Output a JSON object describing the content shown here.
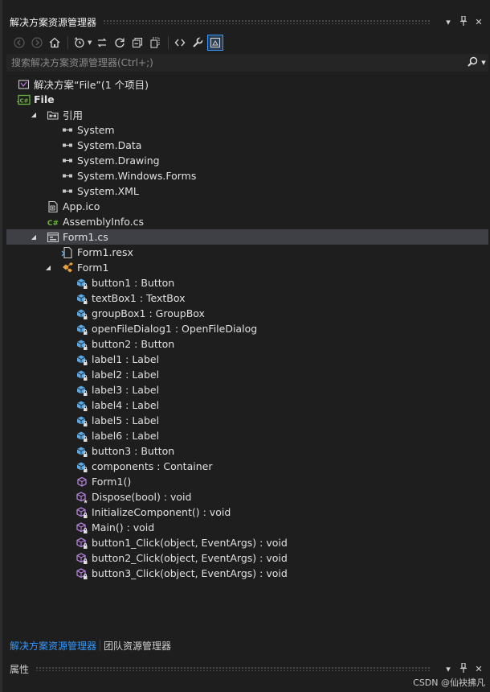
{
  "window": {
    "title": "解决方案资源管理器"
  },
  "window_buttons": {
    "dropdown": "▾",
    "pin": "📌",
    "close": "✕"
  },
  "search": {
    "placeholder": "搜索解决方案资源管理器(Ctrl+;)"
  },
  "tree": [
    {
      "label": "解决方案“File”(1 个项目)",
      "depth": 0,
      "icon": "solution-icon",
      "expander": "",
      "bold": false,
      "selected": false
    },
    {
      "label": "File",
      "depth": 0,
      "icon": "csharp-project-icon",
      "expander": "expanded",
      "bold": true,
      "selected": false
    },
    {
      "label": "引用",
      "depth": 1,
      "icon": "references-icon",
      "expander": "expanded",
      "bold": false,
      "selected": false
    },
    {
      "label": "System",
      "depth": 2,
      "icon": "reference-icon",
      "expander": "",
      "bold": false,
      "selected": false
    },
    {
      "label": "System.Data",
      "depth": 2,
      "icon": "reference-icon",
      "expander": "",
      "bold": false,
      "selected": false
    },
    {
      "label": "System.Drawing",
      "depth": 2,
      "icon": "reference-icon",
      "expander": "",
      "bold": false,
      "selected": false
    },
    {
      "label": "System.Windows.Forms",
      "depth": 2,
      "icon": "reference-icon",
      "expander": "",
      "bold": false,
      "selected": false
    },
    {
      "label": "System.XML",
      "depth": 2,
      "icon": "reference-icon",
      "expander": "",
      "bold": false,
      "selected": false
    },
    {
      "label": "App.ico",
      "depth": 1,
      "icon": "ico-file-icon",
      "expander": "",
      "bold": false,
      "selected": false
    },
    {
      "label": "AssemblyInfo.cs",
      "depth": 1,
      "icon": "csharp-file-icon",
      "expander": "",
      "bold": false,
      "selected": false
    },
    {
      "label": "Form1.cs",
      "depth": 1,
      "icon": "form-icon",
      "expander": "expanded",
      "bold": false,
      "selected": true
    },
    {
      "label": "Form1.resx",
      "depth": 2,
      "icon": "resx-icon",
      "expander": "",
      "bold": false,
      "selected": false
    },
    {
      "label": "Form1",
      "depth": 2,
      "icon": "class-icon",
      "expander": "expanded",
      "bold": false,
      "selected": false
    },
    {
      "label": "button1 : Button",
      "depth": 3,
      "icon": "field-private-icon",
      "expander": "",
      "bold": false,
      "selected": false
    },
    {
      "label": "textBox1 : TextBox",
      "depth": 3,
      "icon": "field-private-icon",
      "expander": "",
      "bold": false,
      "selected": false
    },
    {
      "label": "groupBox1 : GroupBox",
      "depth": 3,
      "icon": "field-private-icon",
      "expander": "",
      "bold": false,
      "selected": false
    },
    {
      "label": "openFileDialog1 : OpenFileDialog",
      "depth": 3,
      "icon": "field-private-icon",
      "expander": "",
      "bold": false,
      "selected": false
    },
    {
      "label": "button2 : Button",
      "depth": 3,
      "icon": "field-private-icon",
      "expander": "",
      "bold": false,
      "selected": false
    },
    {
      "label": "label1 : Label",
      "depth": 3,
      "icon": "field-private-icon",
      "expander": "",
      "bold": false,
      "selected": false
    },
    {
      "label": "label2 : Label",
      "depth": 3,
      "icon": "field-private-icon",
      "expander": "",
      "bold": false,
      "selected": false
    },
    {
      "label": "label3 : Label",
      "depth": 3,
      "icon": "field-private-icon",
      "expander": "",
      "bold": false,
      "selected": false
    },
    {
      "label": "label4 : Label",
      "depth": 3,
      "icon": "field-private-icon",
      "expander": "",
      "bold": false,
      "selected": false
    },
    {
      "label": "label5 : Label",
      "depth": 3,
      "icon": "field-private-icon",
      "expander": "",
      "bold": false,
      "selected": false
    },
    {
      "label": "label6 : Label",
      "depth": 3,
      "icon": "field-private-icon",
      "expander": "",
      "bold": false,
      "selected": false
    },
    {
      "label": "button3 : Button",
      "depth": 3,
      "icon": "field-private-icon",
      "expander": "",
      "bold": false,
      "selected": false
    },
    {
      "label": "components : Container",
      "depth": 3,
      "icon": "field-private-icon",
      "expander": "",
      "bold": false,
      "selected": false
    },
    {
      "label": "Form1()",
      "depth": 3,
      "icon": "method-public-icon",
      "expander": "",
      "bold": false,
      "selected": false
    },
    {
      "label": "Dispose(bool) : void",
      "depth": 3,
      "icon": "method-protected-icon",
      "expander": "",
      "bold": false,
      "selected": false
    },
    {
      "label": "InitializeComponent() : void",
      "depth": 3,
      "icon": "method-private-icon",
      "expander": "",
      "bold": false,
      "selected": false
    },
    {
      "label": "Main() : void",
      "depth": 3,
      "icon": "method-private-icon",
      "expander": "",
      "bold": false,
      "selected": false
    },
    {
      "label": "button1_Click(object, EventArgs) : void",
      "depth": 3,
      "icon": "method-private-icon",
      "expander": "",
      "bold": false,
      "selected": false
    },
    {
      "label": "button2_Click(object, EventArgs) : void",
      "depth": 3,
      "icon": "method-private-icon",
      "expander": "",
      "bold": false,
      "selected": false
    },
    {
      "label": "button3_Click(object, EventArgs) : void",
      "depth": 3,
      "icon": "method-private-icon",
      "expander": "",
      "bold": false,
      "selected": false
    }
  ],
  "tabs": [
    {
      "label": "解决方案资源管理器",
      "active": true
    },
    {
      "label": "团队资源管理器",
      "active": false
    }
  ],
  "properties_panel": {
    "title": "属性"
  },
  "watermark": "CSDN @仙袂拂凡",
  "colors": {
    "background": "#1e1e1e",
    "selection": "#3f3f46",
    "accent": "#3399ff",
    "csharp_green": "#6db33f",
    "field_blue": "#5aa9e6",
    "method_purple": "#b180d7"
  }
}
